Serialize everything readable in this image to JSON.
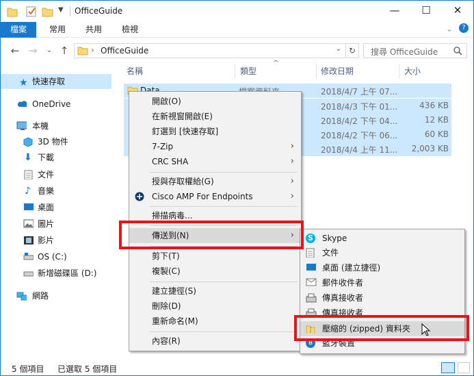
{
  "window": {
    "title": "OfficeGuide",
    "controls": [
      "—",
      "☐",
      "✕"
    ]
  },
  "ribbon": {
    "tabs": [
      "檔案",
      "常用",
      "共用",
      "檢視"
    ]
  },
  "address": {
    "path": "OfficeGuide",
    "search_placeholder": "搜尋 OfficeGuide"
  },
  "nav": {
    "items": [
      {
        "label": "快速存取",
        "icon": "star-icon"
      },
      {
        "label": "OneDrive",
        "icon": "cloud-icon"
      },
      {
        "label": "本機",
        "icon": "computer-icon"
      },
      {
        "label": "3D 物件",
        "icon": "cube-icon"
      },
      {
        "label": "下載",
        "icon": "download-icon"
      },
      {
        "label": "文件",
        "icon": "document-icon"
      },
      {
        "label": "音樂",
        "icon": "music-icon"
      },
      {
        "label": "桌面",
        "icon": "desktop-icon"
      },
      {
        "label": "圖片",
        "icon": "pictures-icon"
      },
      {
        "label": "影片",
        "icon": "video-icon"
      },
      {
        "label": "OS (C:)",
        "icon": "drive-icon"
      },
      {
        "label": "新增磁碟區 (D:)",
        "icon": "drive-icon"
      },
      {
        "label": "網路",
        "icon": "network-icon"
      }
    ]
  },
  "list": {
    "columns": [
      "名稱",
      "類型",
      "修改日期",
      "大小"
    ],
    "rows": [
      {
        "name": "Data",
        "type": "檔案資料夾",
        "date": "2018/4/7 上午 07...",
        "size": ""
      },
      {
        "name": "",
        "type": "",
        "date": "2018/4/3 下午 01...",
        "size": "436 KB"
      },
      {
        "name": "",
        "type": "",
        "date": "2018/4/2 下午 04...",
        "size": "12 KB"
      },
      {
        "name": "",
        "type": "",
        "date": "2018/4/2 下午 06...",
        "size": "60 KB"
      },
      {
        "name": "",
        "type": "",
        "date": "2018/4/4 上午 11...",
        "size": "2,003 KB"
      }
    ]
  },
  "status": {
    "count": "5 個項目",
    "selected": "已選取 5 個項目"
  },
  "context_menu": {
    "items": [
      {
        "label": "開啟(O)"
      },
      {
        "label": "在新視窗開啟(E)"
      },
      {
        "label": "釘選到 [快速存取]"
      },
      {
        "label": "7-Zip",
        "submenu": true
      },
      {
        "label": "CRC SHA",
        "submenu": true
      },
      {
        "label": "授與存取權給(G)",
        "submenu": true
      },
      {
        "label": "Cisco AMP For Endpoints",
        "submenu": true
      },
      {
        "label": "掃描病毒..."
      },
      {
        "label": "傳送到(N)",
        "submenu": true
      },
      {
        "label": "剪下(T)"
      },
      {
        "label": "複製(C)"
      },
      {
        "label": "建立捷徑(S)"
      },
      {
        "label": "刪除(D)"
      },
      {
        "label": "重新命名(M)"
      },
      {
        "label": "內容(R)"
      }
    ]
  },
  "send_to_menu": {
    "items": [
      {
        "label": "Skype",
        "icon": "skype-icon"
      },
      {
        "label": "文件",
        "icon": "document-icon"
      },
      {
        "label": "桌面 (建立捷徑)",
        "icon": "desktop-icon"
      },
      {
        "label": "郵件收件者",
        "icon": "mail-icon"
      },
      {
        "label": "傳真接收者",
        "icon": "fax-icon"
      },
      {
        "label": "傳真接收者",
        "icon": "fax-icon"
      },
      {
        "label": "壓縮的 (zipped) 資料夾",
        "icon": "zip-folder-icon"
      },
      {
        "label": "藍牙裝置",
        "icon": "bluetooth-icon"
      }
    ]
  },
  "colors": {
    "accent": "#1979ca",
    "selection": "#cce8ff",
    "highlight_box": "#e8141c"
  }
}
